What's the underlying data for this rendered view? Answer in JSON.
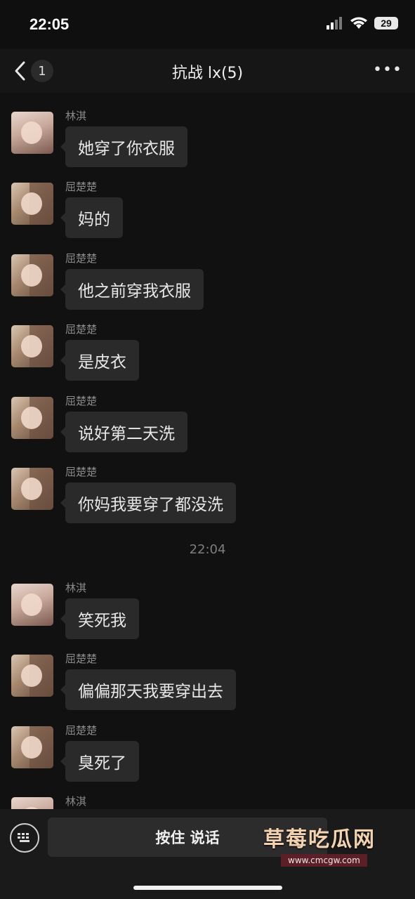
{
  "status": {
    "time": "22:05",
    "battery": "29",
    "icons": [
      "signal-icon",
      "wifi-icon",
      "battery-icon"
    ]
  },
  "header": {
    "title": "抗战 lx(5)",
    "unread_count": "1",
    "back_icon": "chevron-left-icon",
    "more_icon": "more-dots-icon"
  },
  "messages": [
    {
      "sender": "林淇",
      "text": "她穿了你衣服"
    },
    {
      "sender": "屈楚楚",
      "text": "妈的"
    },
    {
      "sender": "屈楚楚",
      "text": "他之前穿我衣服"
    },
    {
      "sender": "屈楚楚",
      "text": "是皮衣"
    },
    {
      "sender": "屈楚楚",
      "text": "说好第二天洗"
    },
    {
      "sender": "屈楚楚",
      "text": "你妈我要穿了都没洗"
    },
    {
      "sender": "林淇",
      "text": "笑死我"
    },
    {
      "sender": "屈楚楚",
      "text": "偏偏那天我要穿出去"
    },
    {
      "sender": "屈楚楚",
      "text": "臭死了"
    },
    {
      "sender": "林淇",
      "text": ""
    }
  ],
  "time_divider": "22:04",
  "input": {
    "hold_to_talk_label": "按住 说话",
    "keyboard_icon": "keyboard-icon"
  },
  "watermark": {
    "brand": "草莓吃瓜网",
    "url": "www.cmcgw.com"
  },
  "colors": {
    "background": "#111111",
    "bubble": "#2a2a2a",
    "sender_name": "#8a8a8a"
  }
}
